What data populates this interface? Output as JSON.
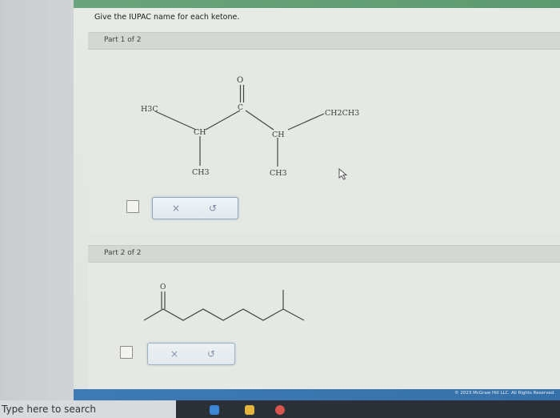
{
  "question": "Give the IUPAC name for each ketone.",
  "part1": {
    "label": "Part 1 of 2",
    "structure": {
      "h3c": "H3C",
      "carbonyl_o": "O",
      "carbonyl_c": "C",
      "ch_left": "CH",
      "ch_right": "CH",
      "ch3_left": "CH3",
      "ch3_right": "CH3",
      "ethyl": "CH2CH3"
    },
    "toolbar": {
      "clear": "×",
      "undo": "↺"
    }
  },
  "part2": {
    "label": "Part 2 of 2",
    "structure": {
      "carbonyl_o": "O"
    },
    "toolbar": {
      "clear": "×",
      "undo": "↺"
    }
  },
  "footer": {
    "copyright": "© 2023 McGraw Hill LLC. All Rights Reserved."
  },
  "taskbar": {
    "search_placeholder": "Type here to search"
  },
  "colors": {
    "accent_blue": "#3e7bb5",
    "top_green": "#6aa47c",
    "tool_border": "#8fa7bd"
  }
}
